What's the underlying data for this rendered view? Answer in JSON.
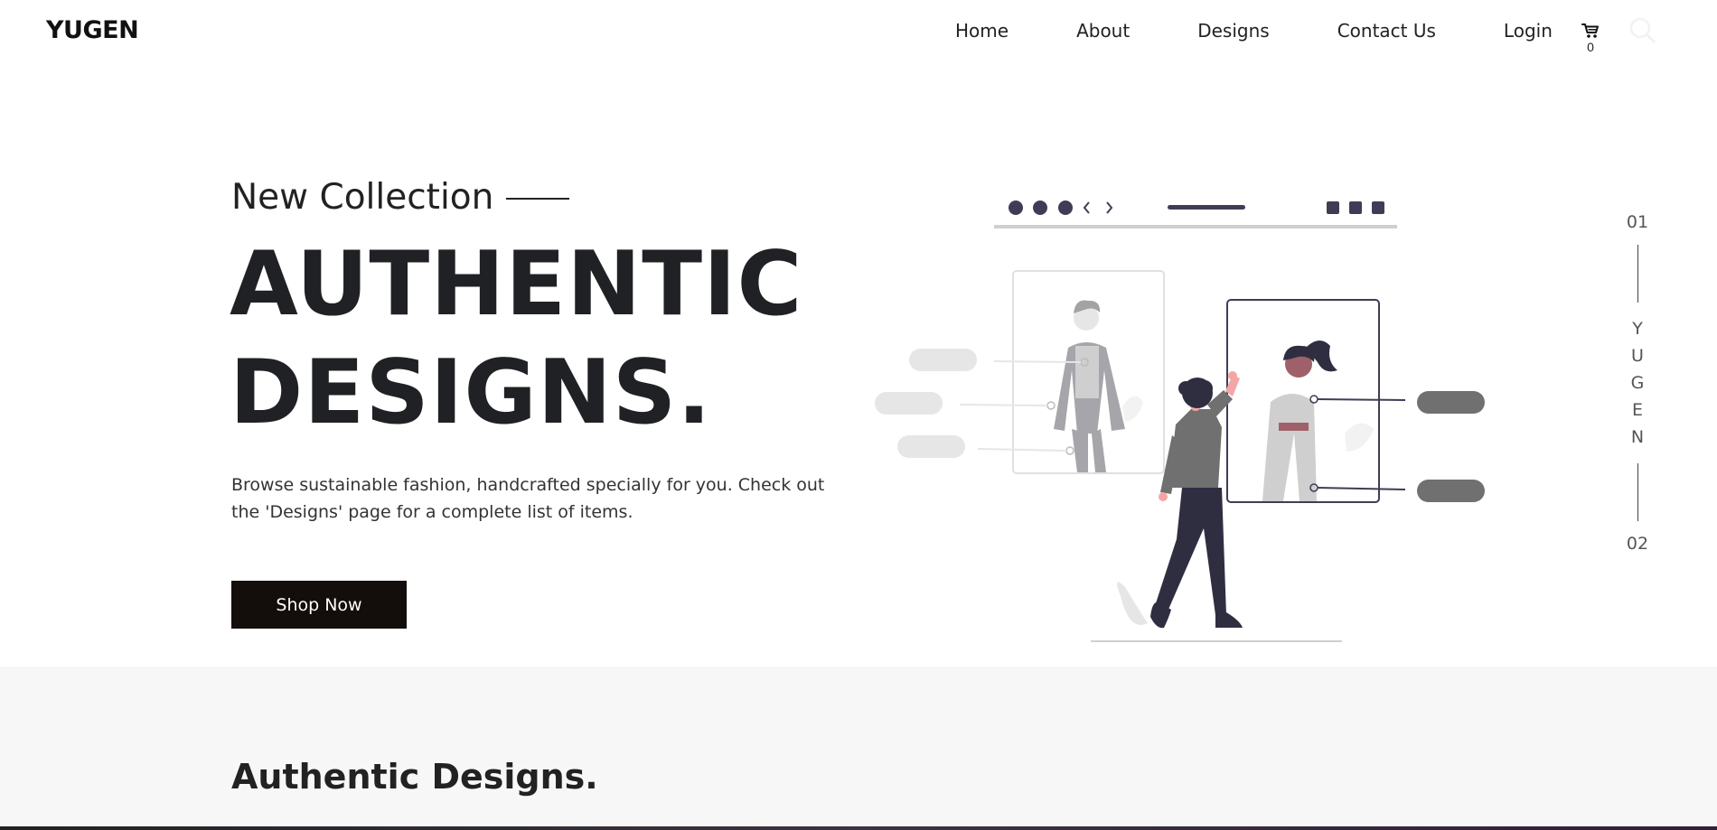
{
  "navbar": {
    "brand": "YUGEN",
    "links": [
      "Home",
      "About",
      "Designs",
      "Contact Us",
      "Login"
    ],
    "cart_count": "0"
  },
  "hero": {
    "subtitle": "New Collection",
    "title_line1": "AUTHENTIC",
    "title_line2": "DESIGNS.",
    "description": "Browse sustainable fashion, handcrafted specially for you. Check out the 'Designs' page for a complete list of items.",
    "cta_label": "Shop Now"
  },
  "side_indicator": {
    "start": "01",
    "letters": [
      "Y",
      "U",
      "G",
      "E",
      "N"
    ],
    "end": "02"
  },
  "section": {
    "title": "Authentic Designs."
  },
  "colors": {
    "button_bg": "#130d0b",
    "section_bg": "#f7f7f7",
    "illustration_dark": "#3f3d56",
    "illustration_gray": "#707070",
    "illustration_accent": "#9e616a"
  },
  "icons": [
    "cart-icon",
    "search-icon",
    "fashion-illustration"
  ]
}
